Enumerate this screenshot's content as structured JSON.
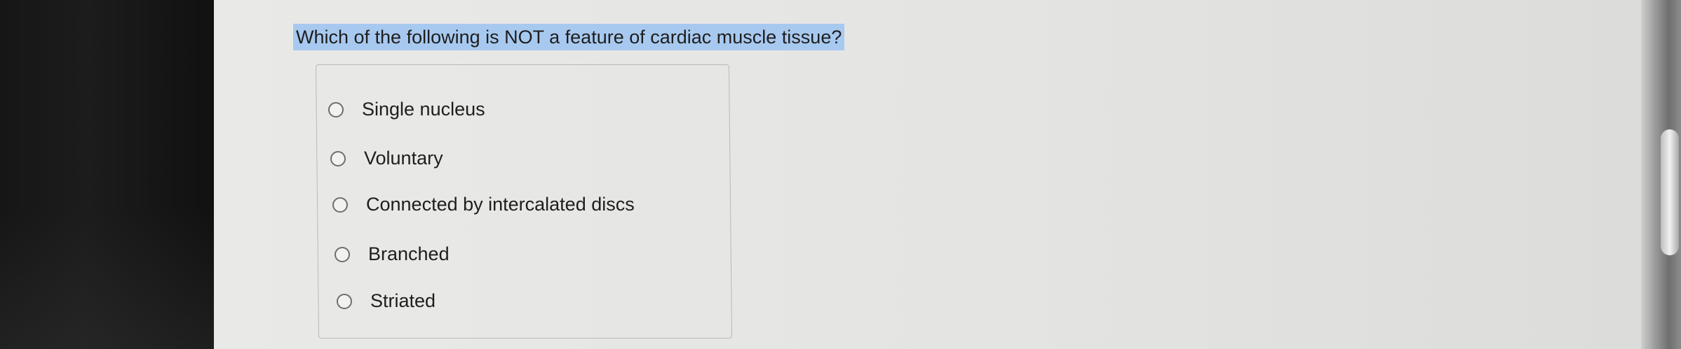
{
  "question": {
    "text": "Which of the following is NOT a feature of cardiac muscle tissue?"
  },
  "options": [
    {
      "label": "Single nucleus",
      "selected": false
    },
    {
      "label": "Voluntary",
      "selected": false
    },
    {
      "label": "Connected by intercalated discs",
      "selected": false
    },
    {
      "label": "Branched",
      "selected": false
    },
    {
      "label": "Striated",
      "selected": false
    }
  ],
  "colors": {
    "question_highlight": "#a8c9ef",
    "text": "#1e1e1e",
    "background": "#e6e6e4"
  }
}
